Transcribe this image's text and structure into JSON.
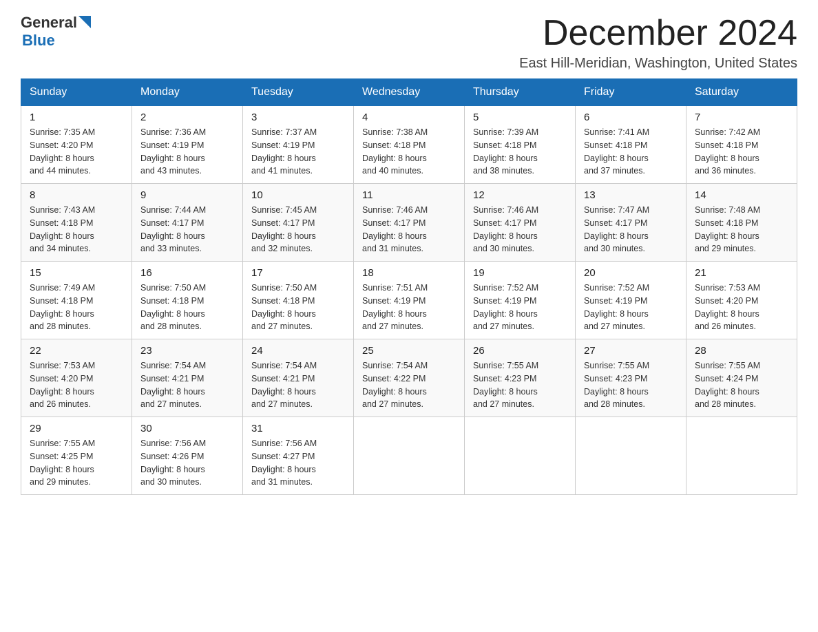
{
  "header": {
    "logo_general": "General",
    "logo_blue": "Blue",
    "month_title": "December 2024",
    "location": "East Hill-Meridian, Washington, United States"
  },
  "weekdays": [
    "Sunday",
    "Monday",
    "Tuesday",
    "Wednesday",
    "Thursday",
    "Friday",
    "Saturday"
  ],
  "weeks": [
    [
      {
        "day": "1",
        "sunrise": "7:35 AM",
        "sunset": "4:20 PM",
        "daylight": "8 hours and 44 minutes."
      },
      {
        "day": "2",
        "sunrise": "7:36 AM",
        "sunset": "4:19 PM",
        "daylight": "8 hours and 43 minutes."
      },
      {
        "day": "3",
        "sunrise": "7:37 AM",
        "sunset": "4:19 PM",
        "daylight": "8 hours and 41 minutes."
      },
      {
        "day": "4",
        "sunrise": "7:38 AM",
        "sunset": "4:18 PM",
        "daylight": "8 hours and 40 minutes."
      },
      {
        "day": "5",
        "sunrise": "7:39 AM",
        "sunset": "4:18 PM",
        "daylight": "8 hours and 38 minutes."
      },
      {
        "day": "6",
        "sunrise": "7:41 AM",
        "sunset": "4:18 PM",
        "daylight": "8 hours and 37 minutes."
      },
      {
        "day": "7",
        "sunrise": "7:42 AM",
        "sunset": "4:18 PM",
        "daylight": "8 hours and 36 minutes."
      }
    ],
    [
      {
        "day": "8",
        "sunrise": "7:43 AM",
        "sunset": "4:18 PM",
        "daylight": "8 hours and 34 minutes."
      },
      {
        "day": "9",
        "sunrise": "7:44 AM",
        "sunset": "4:17 PM",
        "daylight": "8 hours and 33 minutes."
      },
      {
        "day": "10",
        "sunrise": "7:45 AM",
        "sunset": "4:17 PM",
        "daylight": "8 hours and 32 minutes."
      },
      {
        "day": "11",
        "sunrise": "7:46 AM",
        "sunset": "4:17 PM",
        "daylight": "8 hours and 31 minutes."
      },
      {
        "day": "12",
        "sunrise": "7:46 AM",
        "sunset": "4:17 PM",
        "daylight": "8 hours and 30 minutes."
      },
      {
        "day": "13",
        "sunrise": "7:47 AM",
        "sunset": "4:17 PM",
        "daylight": "8 hours and 30 minutes."
      },
      {
        "day": "14",
        "sunrise": "7:48 AM",
        "sunset": "4:18 PM",
        "daylight": "8 hours and 29 minutes."
      }
    ],
    [
      {
        "day": "15",
        "sunrise": "7:49 AM",
        "sunset": "4:18 PM",
        "daylight": "8 hours and 28 minutes."
      },
      {
        "day": "16",
        "sunrise": "7:50 AM",
        "sunset": "4:18 PM",
        "daylight": "8 hours and 28 minutes."
      },
      {
        "day": "17",
        "sunrise": "7:50 AM",
        "sunset": "4:18 PM",
        "daylight": "8 hours and 27 minutes."
      },
      {
        "day": "18",
        "sunrise": "7:51 AM",
        "sunset": "4:19 PM",
        "daylight": "8 hours and 27 minutes."
      },
      {
        "day": "19",
        "sunrise": "7:52 AM",
        "sunset": "4:19 PM",
        "daylight": "8 hours and 27 minutes."
      },
      {
        "day": "20",
        "sunrise": "7:52 AM",
        "sunset": "4:19 PM",
        "daylight": "8 hours and 27 minutes."
      },
      {
        "day": "21",
        "sunrise": "7:53 AM",
        "sunset": "4:20 PM",
        "daylight": "8 hours and 26 minutes."
      }
    ],
    [
      {
        "day": "22",
        "sunrise": "7:53 AM",
        "sunset": "4:20 PM",
        "daylight": "8 hours and 26 minutes."
      },
      {
        "day": "23",
        "sunrise": "7:54 AM",
        "sunset": "4:21 PM",
        "daylight": "8 hours and 27 minutes."
      },
      {
        "day": "24",
        "sunrise": "7:54 AM",
        "sunset": "4:21 PM",
        "daylight": "8 hours and 27 minutes."
      },
      {
        "day": "25",
        "sunrise": "7:54 AM",
        "sunset": "4:22 PM",
        "daylight": "8 hours and 27 minutes."
      },
      {
        "day": "26",
        "sunrise": "7:55 AM",
        "sunset": "4:23 PM",
        "daylight": "8 hours and 27 minutes."
      },
      {
        "day": "27",
        "sunrise": "7:55 AM",
        "sunset": "4:23 PM",
        "daylight": "8 hours and 28 minutes."
      },
      {
        "day": "28",
        "sunrise": "7:55 AM",
        "sunset": "4:24 PM",
        "daylight": "8 hours and 28 minutes."
      }
    ],
    [
      {
        "day": "29",
        "sunrise": "7:55 AM",
        "sunset": "4:25 PM",
        "daylight": "8 hours and 29 minutes."
      },
      {
        "day": "30",
        "sunrise": "7:56 AM",
        "sunset": "4:26 PM",
        "daylight": "8 hours and 30 minutes."
      },
      {
        "day": "31",
        "sunrise": "7:56 AM",
        "sunset": "4:27 PM",
        "daylight": "8 hours and 31 minutes."
      },
      null,
      null,
      null,
      null
    ]
  ],
  "labels": {
    "sunrise": "Sunrise:",
    "sunset": "Sunset:",
    "daylight": "Daylight:"
  }
}
